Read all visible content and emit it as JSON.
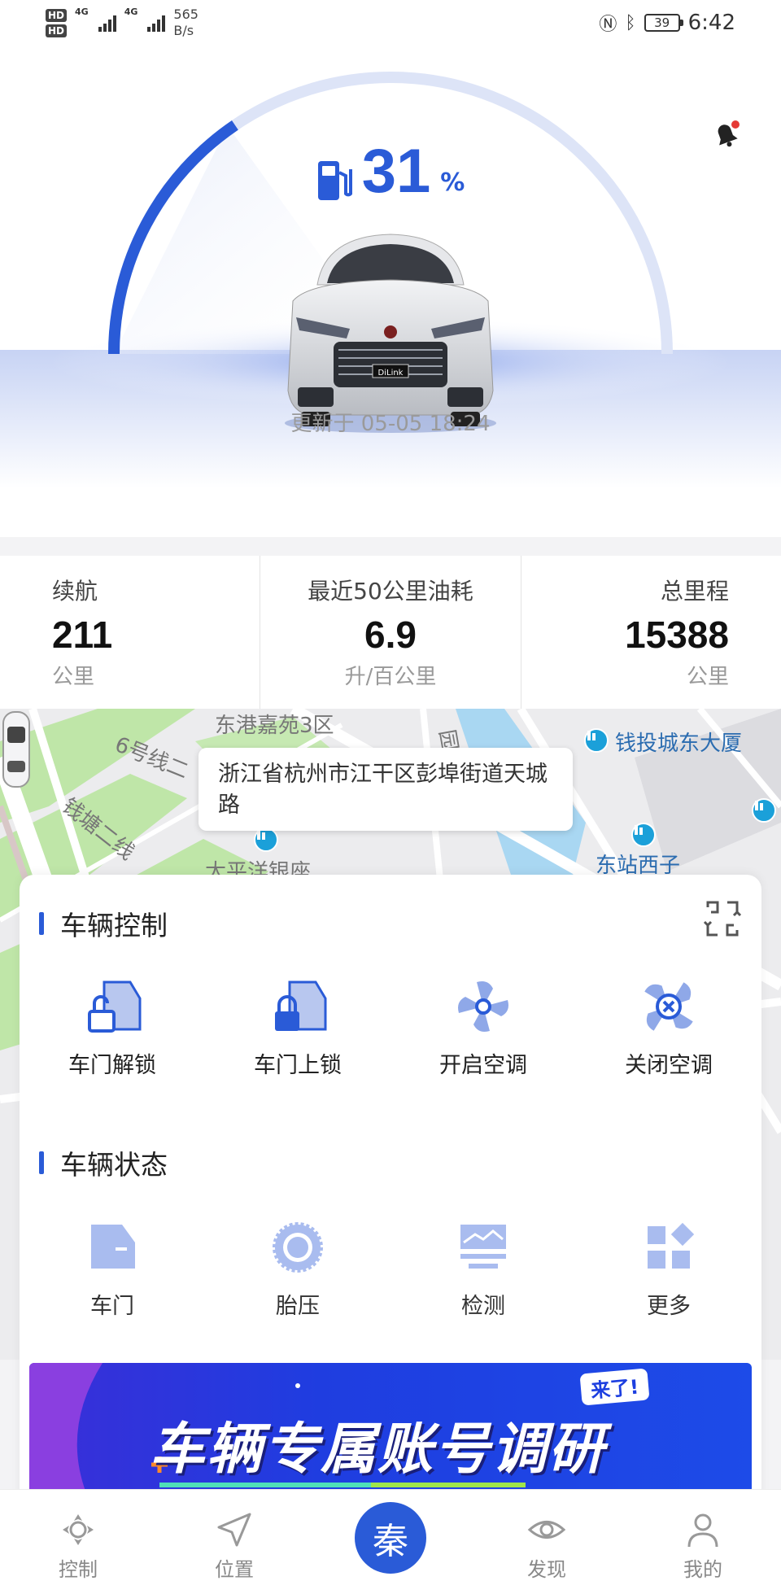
{
  "status_bar": {
    "network_left": "HD",
    "network_1": "4G",
    "network_2": "4G",
    "speed_value": "565",
    "speed_unit": "B/s",
    "battery": "39",
    "time": "6:42"
  },
  "hero": {
    "fuel_value": "31",
    "fuel_unit": "%",
    "fuel_level": 0.31,
    "updated_text": "更新于 05-05 18:24",
    "accent_color": "#2a5bd7"
  },
  "stats": [
    {
      "label": "续航",
      "value": "211",
      "unit": "公里"
    },
    {
      "label": "最近50公里油耗",
      "value": "6.9",
      "unit": "升/百公里"
    },
    {
      "label": "总里程",
      "value": "15388",
      "unit": "公里"
    }
  ],
  "map": {
    "address": "浙江省杭州市江干区彭埠街道天城路",
    "labels": {
      "l1": "东港嘉苑3区",
      "l2": "6号线二",
      "l3": "钱塘二线",
      "l4": "太平洋银座",
      "l5": "钱投城东大厦",
      "l6": "东站西子",
      "l7": "园"
    }
  },
  "control": {
    "title": "车辆控制",
    "items": [
      {
        "label": "车门解锁",
        "icon": "door-unlock-icon"
      },
      {
        "label": "车门上锁",
        "icon": "door-lock-icon"
      },
      {
        "label": "开启空调",
        "icon": "ac-on-icon"
      },
      {
        "label": "关闭空调",
        "icon": "ac-off-icon"
      }
    ]
  },
  "status": {
    "title": "车辆状态",
    "items": [
      {
        "label": "车门",
        "icon": "door-icon"
      },
      {
        "label": "胎压",
        "icon": "tire-icon"
      },
      {
        "label": "检测",
        "icon": "inspection-icon"
      },
      {
        "label": "更多",
        "icon": "more-grid-icon"
      }
    ]
  },
  "banner": {
    "text": "车辆专属账号调研",
    "badge": "来了!"
  },
  "nav": {
    "items": [
      {
        "label": "控制",
        "icon": "control-icon"
      },
      {
        "label": "位置",
        "icon": "location-arrow-icon"
      },
      {
        "label": "",
        "icon": "brand-logo-icon",
        "glyph": "秦"
      },
      {
        "label": "发现",
        "icon": "eye-icon"
      },
      {
        "label": "我的",
        "icon": "profile-icon"
      }
    ]
  }
}
